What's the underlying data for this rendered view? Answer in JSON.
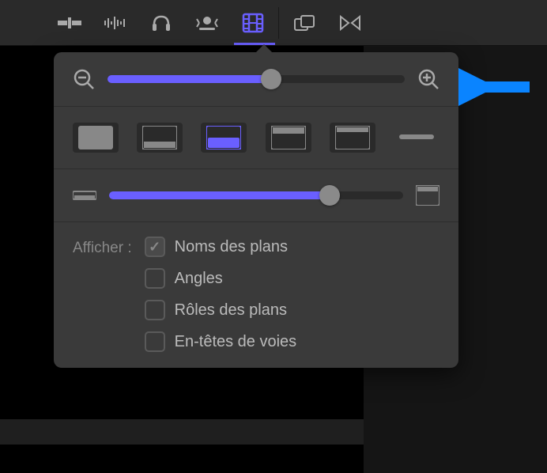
{
  "toolbar": {
    "tools": [
      "snap",
      "audio-wave",
      "headphones",
      "color-balance",
      "filmstrip",
      "range",
      "skip"
    ]
  },
  "popover": {
    "zoom": {
      "value": 55
    },
    "height": {
      "value": 75
    },
    "show_label": "Afficher :",
    "checks": [
      {
        "label": "Noms des plans",
        "checked": true
      },
      {
        "label": "Angles",
        "checked": false
      },
      {
        "label": "Rôles des plans",
        "checked": false
      },
      {
        "label": "En-têtes de voies",
        "checked": false
      }
    ],
    "clip_selected": 2
  },
  "colors": {
    "accent": "#6a5fff",
    "arrow": "#0a84ff"
  }
}
